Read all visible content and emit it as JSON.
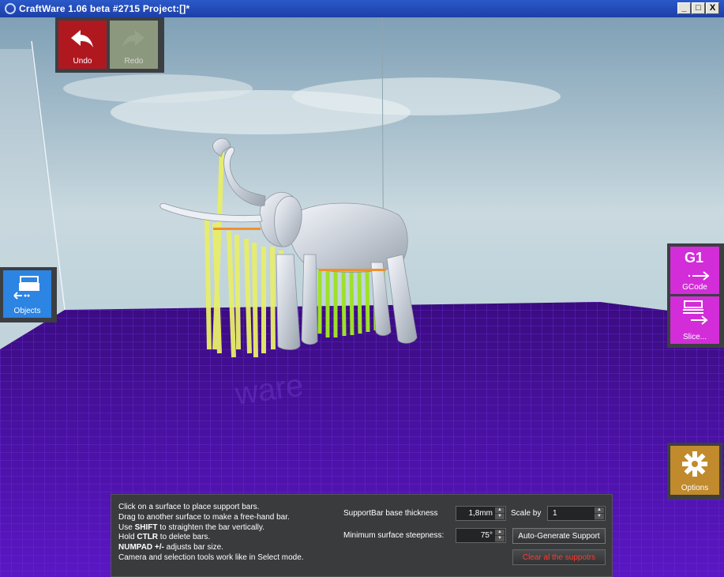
{
  "window": {
    "title": "CraftWare 1.06 beta #2715   Project:[]*",
    "minimize": "_",
    "maximize": "□",
    "close": "X"
  },
  "toolbar": {
    "undo_label": "Undo",
    "undo_icon": "undo-arrow-icon",
    "redo_label": "Redo",
    "redo_icon": "redo-arrow-icon"
  },
  "left_panel": {
    "objects_label": "Objects",
    "objects_icon": "objects-tray-icon"
  },
  "right_panel": {
    "gcode_title": "G1",
    "gcode_label": "GCode",
    "slice_label": "Slice...",
    "options_label": "Options",
    "options_icon": "gear-icon"
  },
  "support_panel": {
    "instructions": [
      {
        "pre": "Click on a surface to place support bars.",
        "kw": "",
        "post": ""
      },
      {
        "pre": "Drag to another surface to make a free-hand bar.",
        "kw": "",
        "post": ""
      },
      {
        "pre": "Use ",
        "kw": "SHIFT",
        "post": " to straighten the bar vertically."
      },
      {
        "pre": "Hold ",
        "kw": "CTLR",
        "post": " to delete bars."
      },
      {
        "pre": "",
        "kw": "NUMPAD +/-",
        "post": " adjusts bar size."
      },
      {
        "pre": "Camera and selection tools work like in Select mode.",
        "kw": "",
        "post": ""
      }
    ],
    "base_thickness_label": "SupportBar base thickness",
    "base_thickness_value": "1,8mm",
    "scale_label": "Scale by",
    "scale_value": "1",
    "steepness_label": "Minimum surface steepness:",
    "steepness_value": "75°",
    "auto_generate_label": "Auto-Generate Support",
    "clear_label": "Clear al the suppotrs"
  },
  "colors": {
    "undo": "#b01820",
    "redo": "#9aa889",
    "objects": "#2c84e3",
    "gcode": "#d22dd8",
    "options": "#c08a2d",
    "floor": "#4a10a8",
    "support_bars": "#e8ee6a",
    "clear_text": "#ff3a2a"
  }
}
